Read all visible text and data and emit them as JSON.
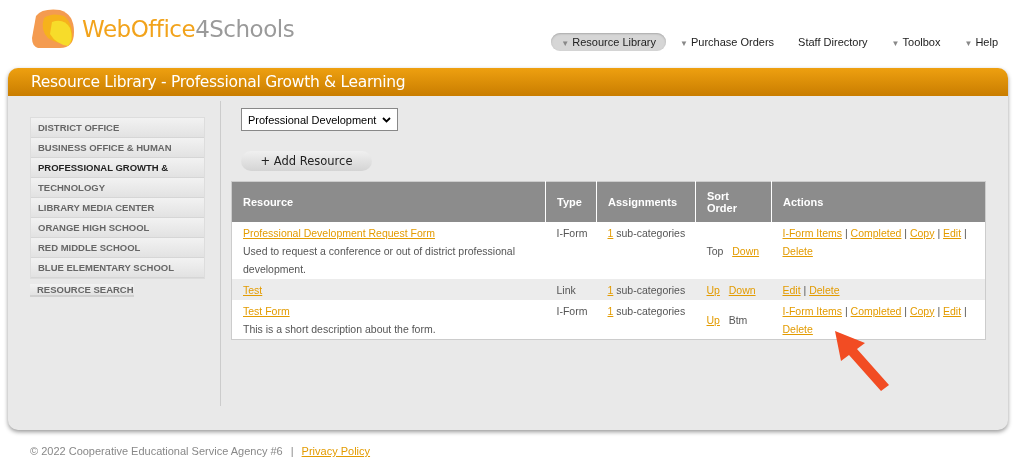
{
  "logo": {
    "brand_primary": "WebOffice",
    "brand_secondary": "4Schools"
  },
  "nav": [
    {
      "label": "Resource Library",
      "dropdown": true,
      "selected": true
    },
    {
      "label": "Purchase Orders",
      "dropdown": true,
      "selected": false
    },
    {
      "label": "Staff Directory",
      "dropdown": false,
      "selected": false
    },
    {
      "label": "Toolbox",
      "dropdown": true,
      "selected": false
    },
    {
      "label": "Help",
      "dropdown": true,
      "selected": false
    }
  ],
  "dropdown_glyph": "▼",
  "page_title": "Resource Library - Professional Growth & Learning",
  "sidebar": {
    "items": [
      {
        "label": "DISTRICT OFFICE",
        "selected": false
      },
      {
        "label": "BUSINESS OFFICE & HUMAN",
        "selected": false
      },
      {
        "label": "PROFESSIONAL GROWTH &",
        "selected": true
      },
      {
        "label": "TECHNOLOGY",
        "selected": false
      },
      {
        "label": "LIBRARY MEDIA CENTER",
        "selected": false
      },
      {
        "label": "ORANGE HIGH SCHOOL",
        "selected": false
      },
      {
        "label": "RED MIDDLE SCHOOL",
        "selected": false
      },
      {
        "label": "BLUE ELEMENTARY SCHOOL",
        "selected": false
      }
    ],
    "search": "RESOURCE SEARCH"
  },
  "category_select": {
    "value": "Professional Development"
  },
  "add_button": {
    "icon": "+",
    "label": "Add Resource"
  },
  "table": {
    "columns": [
      "Resource",
      "Type",
      "Assignments",
      "Sort Order",
      "Actions"
    ],
    "action_separator": "|",
    "rows": [
      {
        "title": "Professional Development Request Form",
        "description": "Used to request a conference or out of district professional development.",
        "type": "I-Form",
        "assignments_count": "1",
        "assignments_text": "sub-categories",
        "sort": [
          {
            "kind": "text",
            "label": "Top"
          },
          {
            "kind": "link",
            "label": "Down"
          }
        ],
        "actions": [
          "I-Form Items",
          "Completed",
          "Copy",
          "Edit",
          "Delete"
        ]
      },
      {
        "title": "Test",
        "type": "Link",
        "assignments_count": "1",
        "assignments_text": "sub-categories",
        "sort": [
          {
            "kind": "link",
            "label": "Up"
          },
          {
            "kind": "link",
            "label": "Down"
          }
        ],
        "actions": [
          "Edit",
          "Delete"
        ]
      },
      {
        "title": "Test Form",
        "description": "This is a short description about the form.",
        "type": "I-Form",
        "assignments_count": "1",
        "assignments_text": "sub-categories",
        "sort": [
          {
            "kind": "link",
            "label": "Up"
          },
          {
            "kind": "text",
            "label": "Btm"
          }
        ],
        "actions": [
          "I-Form Items",
          "Completed",
          "Copy",
          "Edit",
          "Delete"
        ]
      }
    ]
  },
  "footer": {
    "copyright": "© 2022 Cooperative Educational Service Agency #6",
    "separator": "|",
    "link": "Privacy Policy"
  }
}
